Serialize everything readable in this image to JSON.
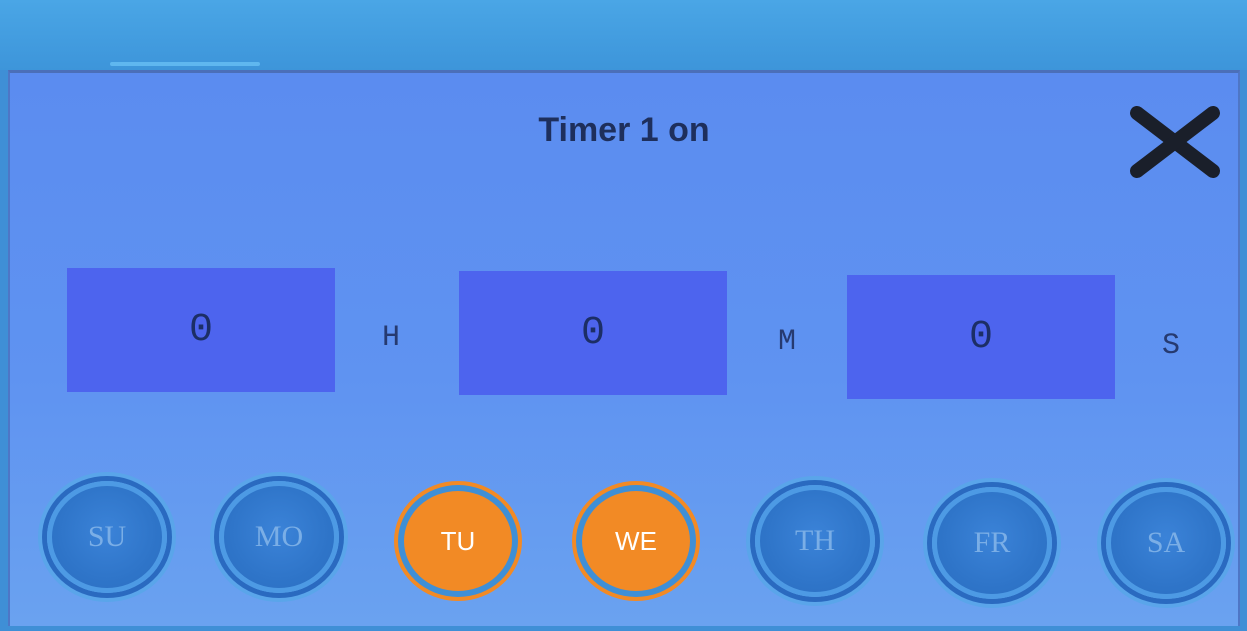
{
  "dialog": {
    "title": "Timer 1 on",
    "close_icon": "close-icon"
  },
  "time": {
    "hours": "0",
    "hours_unit": "H",
    "minutes": "0",
    "minutes_unit": "M",
    "seconds": "0",
    "seconds_unit": "S"
  },
  "days": [
    {
      "label": "SU",
      "selected": false
    },
    {
      "label": "MO",
      "selected": false
    },
    {
      "label": "TU",
      "selected": true
    },
    {
      "label": "WE",
      "selected": true
    },
    {
      "label": "TH",
      "selected": false
    },
    {
      "label": "FR",
      "selected": false
    },
    {
      "label": "SA",
      "selected": false
    }
  ],
  "colors": {
    "dialog_bg": "#5f93f1",
    "time_box": "#4d64ee",
    "day_selected": "#f28a25",
    "day_unselected": "#2f75c9"
  }
}
